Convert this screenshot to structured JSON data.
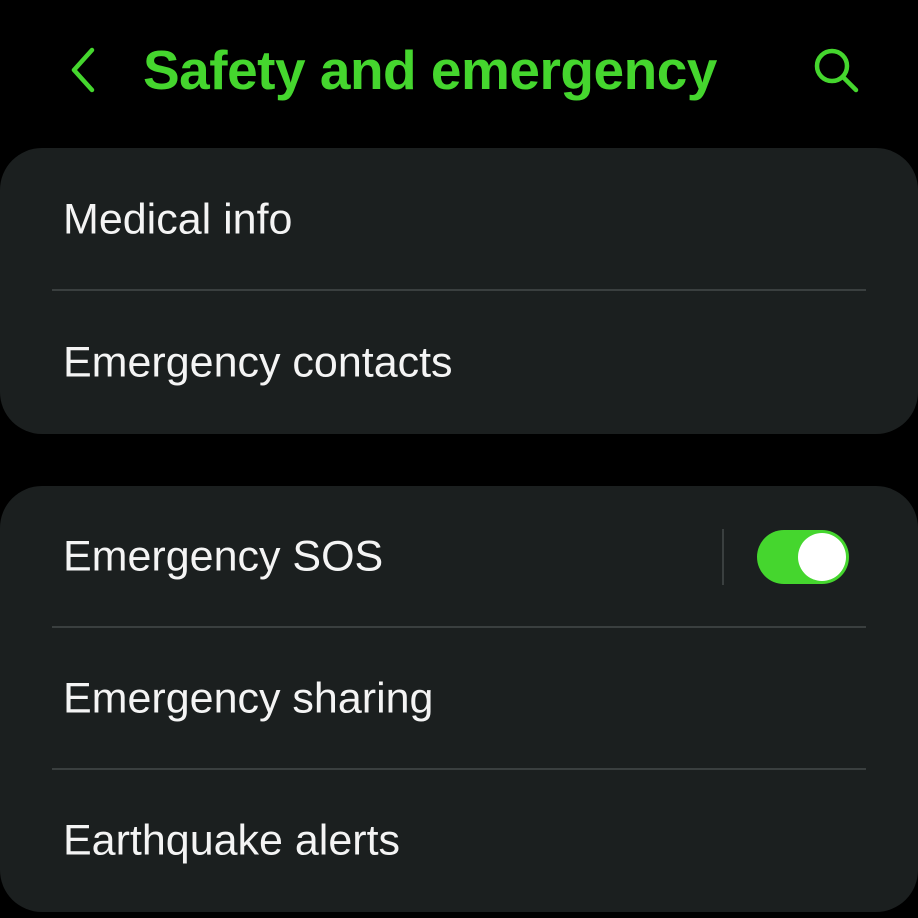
{
  "colors": {
    "accent": "#45d62e",
    "background": "#000000",
    "card": "#1b1f1f",
    "text": "#f4f4f4",
    "divider": "#3a3f3f"
  },
  "header": {
    "title": "Safety and emergency",
    "back_icon": "chevron-left-icon",
    "search_icon": "search-icon"
  },
  "groups": [
    {
      "items": [
        {
          "label": "Medical info"
        },
        {
          "label": "Emergency contacts"
        }
      ]
    },
    {
      "items": [
        {
          "label": "Emergency SOS",
          "toggle": true
        },
        {
          "label": "Emergency sharing"
        },
        {
          "label": "Earthquake alerts"
        }
      ]
    }
  ]
}
